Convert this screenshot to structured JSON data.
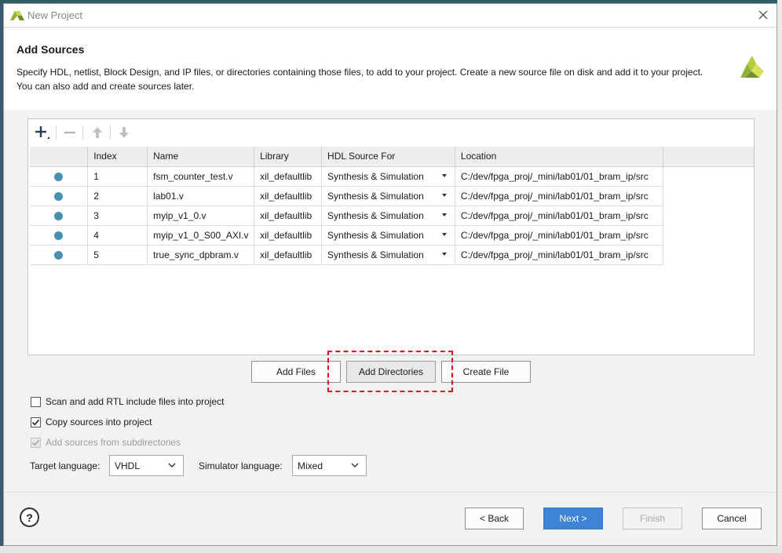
{
  "window": {
    "title": "New Project",
    "close_icon": "close-icon",
    "app_icon": "vivado-logo-icon"
  },
  "header": {
    "title": "Add Sources",
    "description_line1": "Specify HDL, netlist, Block Design, and IP files, or directories containing those files, to add to your project. Create a new source file on disk and add it to your project.",
    "description_line2": "You can also add and create sources later."
  },
  "toolbar": {
    "add_icon": "plus-icon",
    "remove_icon": "minus-icon",
    "up_icon": "arrow-up-icon",
    "down_icon": "arrow-down-icon"
  },
  "table": {
    "columns": [
      "",
      "Index",
      "Name",
      "Library",
      "HDL Source For",
      "Location"
    ],
    "rows": [
      {
        "index": "1",
        "name": "fsm_counter_test.v",
        "library": "xil_defaultlib",
        "hdl_source_for": "Synthesis & Simulation",
        "location": "C:/dev/fpga_proj/_mini/lab01/01_bram_ip/src"
      },
      {
        "index": "2",
        "name": "lab01.v",
        "library": "xil_defaultlib",
        "hdl_source_for": "Synthesis & Simulation",
        "location": "C:/dev/fpga_proj/_mini/lab01/01_bram_ip/src"
      },
      {
        "index": "3",
        "name": "myip_v1_0.v",
        "library": "xil_defaultlib",
        "hdl_source_for": "Synthesis & Simulation",
        "location": "C:/dev/fpga_proj/_mini/lab01/01_bram_ip/src"
      },
      {
        "index": "4",
        "name": "myip_v1_0_S00_AXI.v",
        "library": "xil_defaultlib",
        "hdl_source_for": "Synthesis & Simulation",
        "location": "C:/dev/fpga_proj/_mini/lab01/01_bram_ip/src"
      },
      {
        "index": "5",
        "name": "true_sync_dpbram.v",
        "library": "xil_defaultlib",
        "hdl_source_for": "Synthesis & Simulation",
        "location": "C:/dev/fpga_proj/_mini/lab01/01_bram_ip/src"
      }
    ]
  },
  "actions": {
    "add_files_pre": "Add Files",
    "add_directories": "Add Directories",
    "create_file": "Create File"
  },
  "options": {
    "scan_rtl": {
      "label": "Scan and add RTL include files into project",
      "checked": false
    },
    "copy_sources": {
      "label": "Copy sources into project",
      "checked": true
    },
    "add_subdirs": {
      "label": "Add sources from subdirectories",
      "checked": true,
      "disabled": true
    }
  },
  "language": {
    "target_label": "Target language:",
    "target_value": "VHDL",
    "simulator_label": "Simulator language:",
    "simulator_value": "Mixed"
  },
  "footer": {
    "help_label": "?",
    "back": "< Back",
    "next": "Next >",
    "finish": "Finish",
    "cancel": "Cancel"
  },
  "colors": {
    "accent": "#3f83d6",
    "status_dot": "#4a8fb2",
    "highlight": "#e0141e"
  }
}
